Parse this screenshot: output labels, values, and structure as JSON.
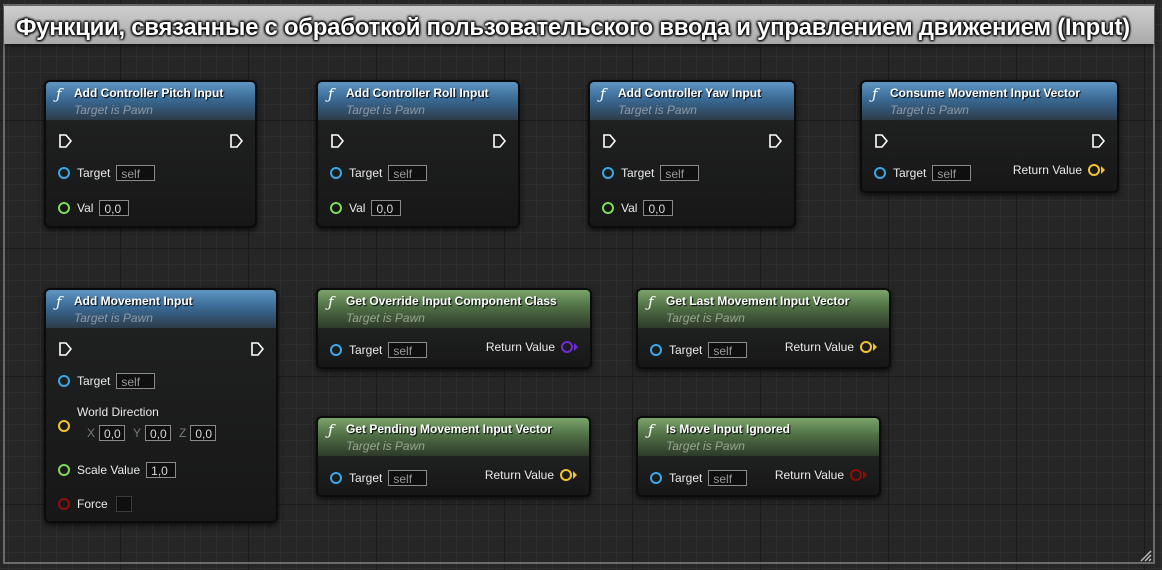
{
  "comment": {
    "title": "Функции, связанные с обработкой пользовательского ввода и управлением движением (Input)"
  },
  "labels": {
    "target": "Target",
    "self": "self",
    "val": "Val",
    "return_value": "Return Value"
  },
  "nodes": {
    "pitch": {
      "title": "Add Controller Pitch Input",
      "subtitle": "Target is Pawn",
      "val": "0,0"
    },
    "roll": {
      "title": "Add Controller Roll Input",
      "subtitle": "Target is Pawn",
      "val": "0,0"
    },
    "yaw": {
      "title": "Add Controller Yaw Input",
      "subtitle": "Target is Pawn",
      "val": "0,0"
    },
    "consume": {
      "title": "Consume Movement Input Vector",
      "subtitle": "Target is Pawn"
    },
    "movement": {
      "title": "Add Movement Input",
      "subtitle": "Target is Pawn",
      "world_direction": "World Direction",
      "x_label": "X",
      "x": "0,0",
      "y_label": "Y",
      "y": "0,0",
      "z_label": "Z",
      "z": "0,0",
      "scale_label": "Scale Value",
      "scale": "1,0",
      "force_label": "Force"
    },
    "override": {
      "title": "Get Override Input Component Class",
      "subtitle": "Target is Pawn"
    },
    "last": {
      "title": "Get Last Movement Input Vector",
      "subtitle": "Target is Pawn"
    },
    "pending": {
      "title": "Get Pending Movement Input Vector",
      "subtitle": "Target is Pawn"
    },
    "ignored": {
      "title": "Is Move Input Ignored",
      "subtitle": "Target is Pawn"
    }
  },
  "colors": {
    "function_header_blue": "#3a6a94",
    "pure_header_green": "#4f7045",
    "pin_object": "#38a8e6",
    "pin_float": "#7ed957",
    "pin_vector": "#f4c430",
    "pin_class": "#6d2bd9",
    "pin_bool": "#960a0a"
  }
}
